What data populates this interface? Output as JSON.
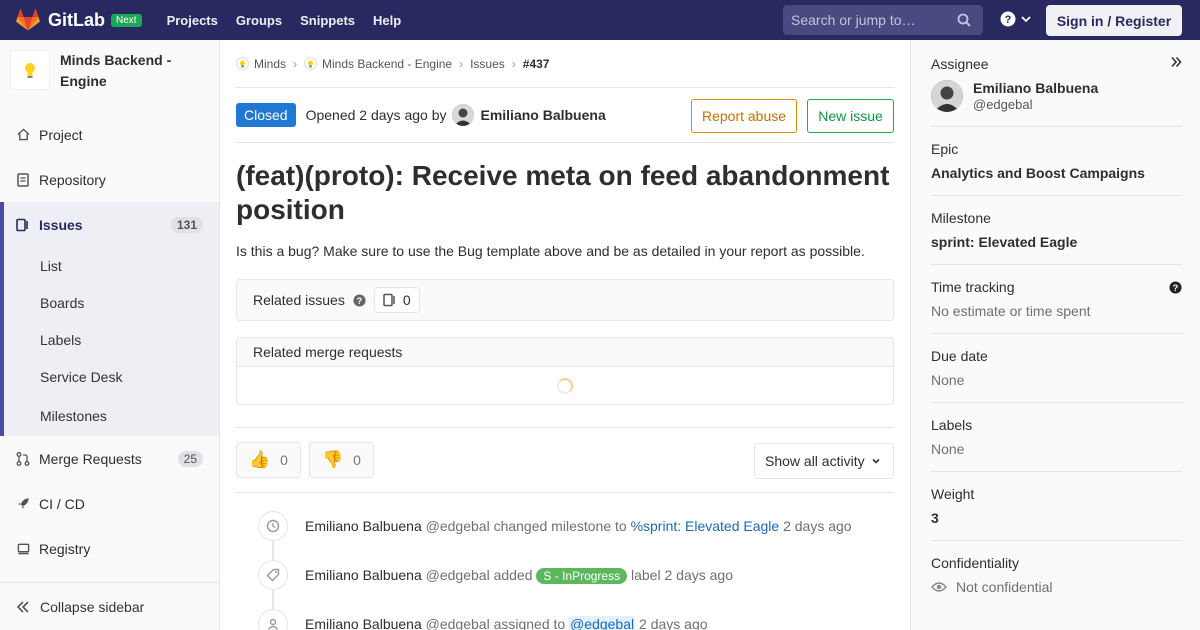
{
  "topbar": {
    "logo_text": "GitLab",
    "badge": "Next",
    "links": [
      "Projects",
      "Groups",
      "Snippets",
      "Help"
    ],
    "search_placeholder": "Search or jump to…",
    "signin": "Sign in / Register"
  },
  "sidebar": {
    "project_name": "Minds Backend - Engine",
    "items": {
      "project": "Project",
      "repository": "Repository",
      "issues": "Issues",
      "issues_count": "131",
      "merge_requests": "Merge Requests",
      "mr_count": "25",
      "cicd": "CI / CD",
      "registry": "Registry"
    },
    "issues_sub": [
      "List",
      "Boards",
      "Labels",
      "Service Desk",
      "Milestones"
    ],
    "collapse": "Collapse sidebar"
  },
  "breadcrumb": {
    "group": "Minds",
    "project": "Minds Backend - Engine",
    "section": "Issues",
    "current": "#437"
  },
  "issue": {
    "status": "Closed",
    "opened_text": "Opened 2 days ago by",
    "author": "Emiliano Balbuena",
    "report_abuse": "Report abuse",
    "new_issue": "New issue",
    "title": "(feat)(proto): Receive meta on feed abandonment position",
    "description": "Is this a bug? Make sure to use the Bug template above and be as detailed in your report as possible.",
    "related_issues_label": "Related issues",
    "related_issues_count": "0",
    "related_mr_label": "Related merge requests",
    "thumbs_up": "0",
    "thumbs_down": "0",
    "activity_filter": "Show all activity"
  },
  "timeline": [
    {
      "author": "Emiliano Balbuena",
      "handle": "@edgebal",
      "action": "changed milestone to",
      "target": "%sprint: Elevated Eagle",
      "time": "2 days ago"
    },
    {
      "author": "Emiliano Balbuena",
      "handle": "@edgebal",
      "action": "added",
      "label": "S - InProgress",
      "suffix": "label",
      "time": "2 days ago"
    },
    {
      "author": "Emiliano Balbuena",
      "handle": "@edgebal",
      "action": "assigned to",
      "mention": "@edgebal",
      "time": "2 days ago"
    }
  ],
  "rightbar": {
    "assignee_label": "Assignee",
    "assignee_name": "Emiliano Balbuena",
    "assignee_handle": "@edgebal",
    "epic_label": "Epic",
    "epic_value": "Analytics and Boost Campaigns",
    "milestone_label": "Milestone",
    "milestone_value": "sprint: Elevated Eagle",
    "time_label": "Time tracking",
    "time_value": "No estimate or time spent",
    "due_label": "Due date",
    "due_value": "None",
    "labels_label": "Labels",
    "labels_value": "None",
    "weight_label": "Weight",
    "weight_value": "3",
    "conf_label": "Confidentiality",
    "conf_value": "Not confidential"
  },
  "colors": {
    "topbar": "#292961",
    "closed": "#1f78d1",
    "label_inprogress": "#5cb85c"
  }
}
